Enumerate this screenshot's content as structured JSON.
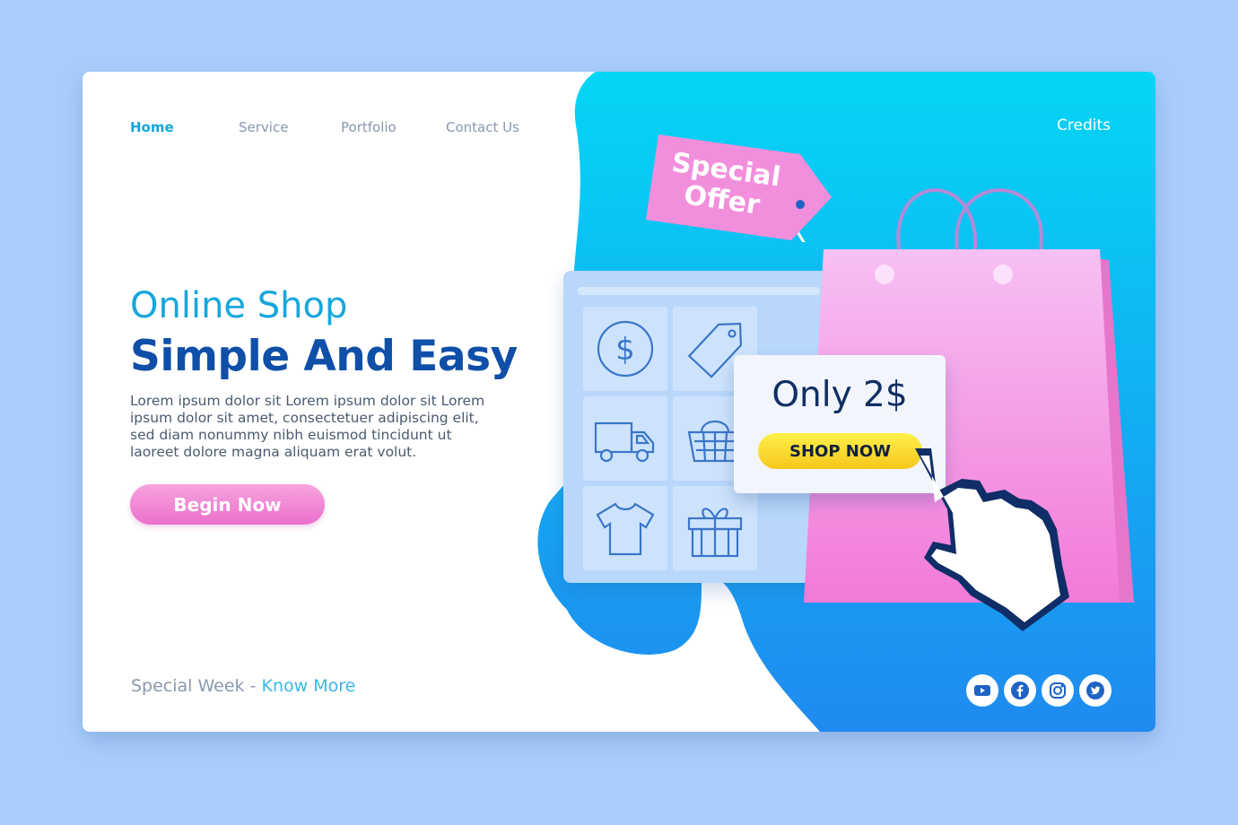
{
  "nav": {
    "items": [
      {
        "label": "Home",
        "active": true
      },
      {
        "label": "Service"
      },
      {
        "label": "Portfolio"
      },
      {
        "label": "Contact Us"
      }
    ],
    "credits": "Credits"
  },
  "hero": {
    "subtitle": "Online Shop",
    "title": "Simple And Easy",
    "body": "Lorem ipsum dolor sit Lorem ipsum dolor sit Lorem ipsum dolor sit amet, consectetuer adipiscing elit, sed diam nonummy nibh euismod tincidunt ut laoreet dolore magna aliquam erat volut.",
    "cta": "Begin Now"
  },
  "footer": {
    "prefix": "Special Week - ",
    "link": "Know More"
  },
  "illustration": {
    "tag_text": "Special Offer",
    "price": "Only 2$",
    "shop_button": "SHOP NOW",
    "grid_icons": [
      "dollar-coin-icon",
      "price-tag-icon",
      "truck-icon",
      "basket-icon",
      "tshirt-icon",
      "gift-box-icon"
    ]
  },
  "socials": [
    "youtube-icon",
    "facebook-icon",
    "instagram-icon",
    "twitter-icon"
  ],
  "colors": {
    "page_bg": "#a9cdfb",
    "accent_blue": "#17a7dc",
    "title_blue": "#0f4fa8",
    "pink": "#ea6fcc",
    "yellow": "#f6c71c"
  }
}
